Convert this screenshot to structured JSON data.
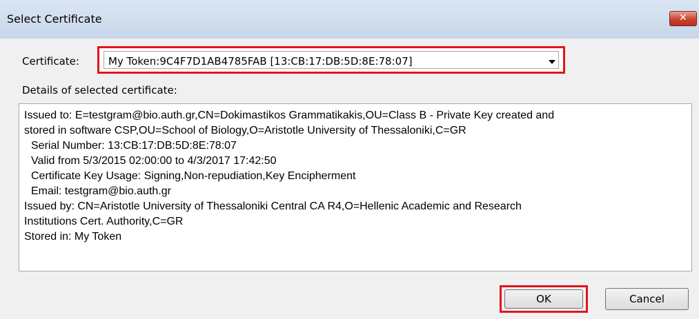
{
  "window": {
    "title": "Select Certificate",
    "close_glyph": "✕"
  },
  "certificate": {
    "label": "Certificate:",
    "selected": "My Token:9C4F7D1AB4785FAB [13:CB:17:DB:5D:8E:78:07]"
  },
  "details": {
    "label": "Details of selected certificate:",
    "lines": [
      "Issued to: E=testgram@bio.auth.gr,CN=Dokimastikos Grammatikakis,OU=Class B - Private Key created and",
      "stored in software CSP,OU=School of Biology,O=Aristotle University of Thessaloniki,C=GR",
      "Serial Number: 13:CB:17:DB:5D:8E:78:07",
      "Valid from 5/3/2015 02:00:00 to 4/3/2017 17:42:50",
      "Certificate Key Usage: Signing,Non-repudiation,Key Encipherment",
      "Email: testgram@bio.auth.gr",
      "Issued by: CN=Aristotle University of Thessaloniki Central CA R4,O=Hellenic Academic and Research",
      "Institutions Cert. Authority,C=GR",
      "Stored in: My Token"
    ]
  },
  "buttons": {
    "ok": "OK",
    "cancel": "Cancel"
  },
  "colors": {
    "highlight": "#e2141c",
    "titlebar": "#c7d6ea",
    "close": "#c9442f"
  }
}
